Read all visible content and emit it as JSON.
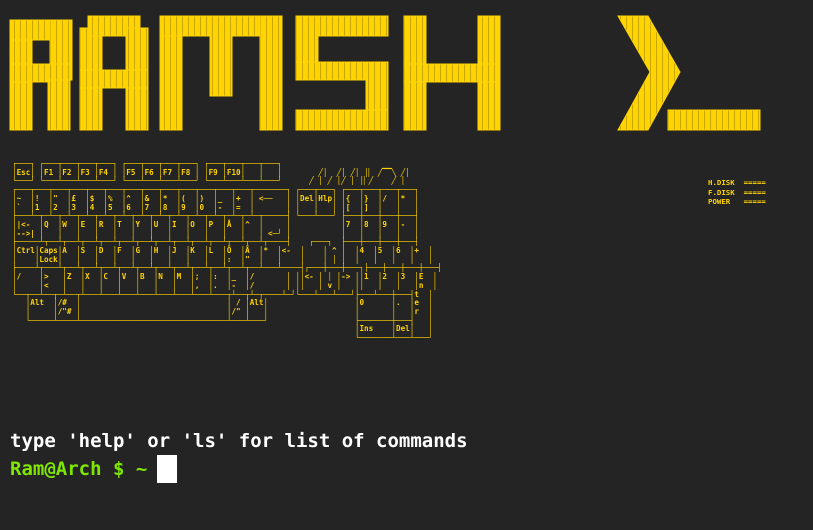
{
  "banner": {
    "text": "RAMSH",
    "symbol": "❯_",
    "color": "#ffd400"
  },
  "keyboard": {
    "art": "┌───┐ ┌───┬───┬───┬───┐ ┌───┬───┬───┬───┐ ┌───┬───┬───┬───┐\n│Esc│ │F1 │F2 │F3 │F4 │ │F5 │F6 │F7 │F8 │ │F9 │F10│   │   │        ╱│  ╱│ ╱│ │▏ ╱▔▔╲ ╱│\n└───┘ └───┴───┴───┴───┘ └───┴───┴───┴───┘ └───┴───┴───┴───┘      ╱ │ ╱ │╱ │ │▏╱    ╱ │\n┌───┬───┬───┬───┬───┬───┬───┬───┬───┬───┬───┬───┬───┬───────┐ ┌───┬───┐ ┌───┬───┬───┬───┐\n│~  │!  │\"  │£  │$  │%  │^  │&  │*  │(  │)  │_  │+  │ <──   │ │Del│Hlp│ │{  │}  │/  │*  │\n│`  │1  │2  │3  │4  │5  │6  │7  │8  │9  │0  │-  │=  │       │ │   │   │ │[  │]  │   │   │\n├───┴─┬─┴─┬─┴─┬─┴─┬─┴─┬─┴─┬─┴─┬─┴─┬─┴─┬─┴─┬─┴─┬─┴─┬─┴─┬─────┤ └───┴───┘ ├───┼───┼───┼───┤\n│|<-  │Q  │W  │E  │R  │T  │Y  │U  │I  │O  │P  │Å  │^  │     │           │7  │8  │9  │-  │\n│-->| │   │   │   │   │   │   │   │   │   │   │   │   │ <─┘ │           │   │   │   │   │\n├─────┴┬──┴┬──┴┬──┴┬──┴┬──┴┬──┴┬──┴┬──┴┬──┴┬──┴┬──┴┬──┴┬────┤    ┌───┐  ├───┼───┼───┼───┤\n│Ctrl│Caps│A  │S  │D  │F  │G  │H  │J  │K  │L  │Ö  │Ä  │*  │<-  │    │ ^ │  │4  │5  │6  │+  │\n│    │Lock│   │   │   │   │   │   │   │   │   │:  │\"  │   │    │    │ │ │  │   │   │   │   │\n├────┴┬───┴┬──┴┬──┴┬──┴┬──┴┬──┴┬──┴┬──┴┬──┴┬──┴┬──┴┬──┴───┴────┤┌───┼───┼───┐├───┼───┼───┼───┤\n│/    │>   │Z  │X  │C  │V  │B  │N  │M  │;  │:  │_  │/       │ ││<- │ │ │-> ││1  │2  │3  │E  │\n│     │<   │   │   │   │   │   │   │   │,  │.  │-  │/       │ ││   │ v │   ││   │   │   │n  │\n└──┬──┴──┬─┴──┬┴───┴───┴───┴───┴───┴───┴───┴───┬┴──┬┴─┬────┴─┘└───┴───┴───┘├───┴───┼───┤t  │\n   │Alt  │/#  │                                │ / │Alt│                   │0      │.  │e  │\n   │     │/\"# │                                │/\" │   │                   │       │   │r  │\n   └─────┴────┴────────────────────────────────┴───┴───┘                   ├───────┼───┤   │\n                                                                           │Ins    │Del│   │\n                                                                           └───────┴───┴───┘",
    "color": "#ffd400"
  },
  "drive_status": {
    "text": "H.DISK  =====\nF.DISK  =====\nPOWER   ====="
  },
  "terminal": {
    "help_text": "type 'help' or 'ls' for list of commands",
    "prompt": "Ram@Arch $ ~",
    "prompt_color": "#7fe600",
    "input_value": ""
  }
}
